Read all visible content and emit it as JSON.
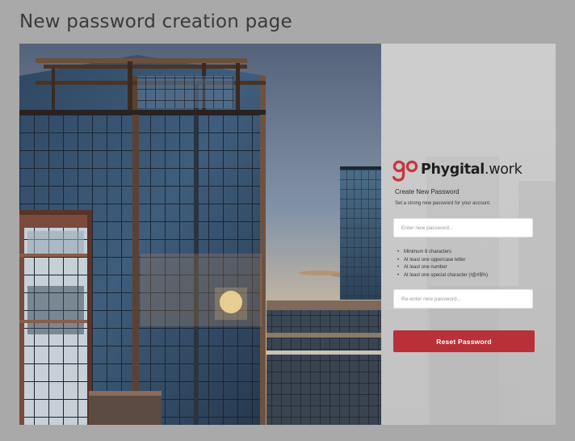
{
  "page": {
    "title": "New password creation page"
  },
  "brand": {
    "logo_mark": "go",
    "name_bold": "Phygital",
    "name_suffix": ".work"
  },
  "form": {
    "heading": "Create New Password",
    "subheading": "Set a strong new password for your account.",
    "new_password": {
      "placeholder": "Enter new password...",
      "value": ""
    },
    "confirm_password": {
      "placeholder": "Re-enter new password...",
      "value": ""
    },
    "requirements": [
      "Minimum 8 characters",
      "At least one uppercase letter",
      "At least one number",
      "At least one special character (!@#$%)"
    ],
    "submit_label": "Reset Password"
  },
  "colors": {
    "accent": "#b93038",
    "logo_red": "#c8343b",
    "page_bg": "#a9a9a9"
  }
}
